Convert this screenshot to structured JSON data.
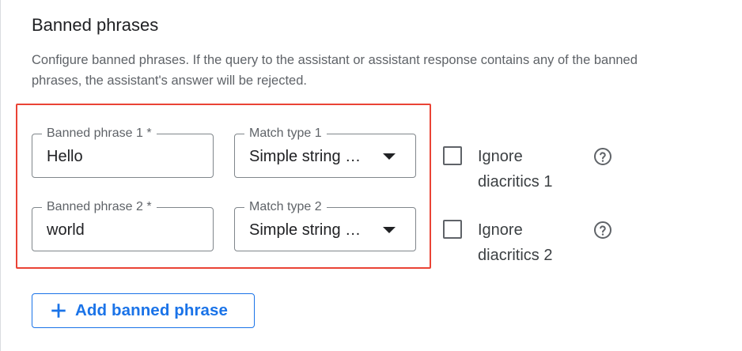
{
  "section": {
    "title": "Banned phrases",
    "description": "Configure banned phrases. If the query to the assistant or assistant response contains any of the banned phrases, the assistant's answer will be rejected."
  },
  "rows": [
    {
      "phrase_label": "Banned phrase 1 *",
      "phrase_value": "Hello",
      "match_label": "Match type 1",
      "match_value": "Simple string …",
      "ignore_line1": "Ignore",
      "ignore_line2": "diacritics 1",
      "ignore_checked": false,
      "help_icon": "help-circle-icon"
    },
    {
      "phrase_label": "Banned phrase 2 *",
      "phrase_value": "world",
      "match_label": "Match type 2",
      "match_value": "Simple string …",
      "ignore_line1": "Ignore",
      "ignore_line2": "diacritics 2",
      "ignore_checked": false,
      "help_icon": "help-circle-icon"
    }
  ],
  "add_button": {
    "label": "Add banned phrase",
    "icon": "plus-icon"
  },
  "colors": {
    "accent": "#1a73e8",
    "highlight": "#ea4335",
    "text": "#202124",
    "muted": "#5f6368",
    "outline": "#80868b"
  }
}
